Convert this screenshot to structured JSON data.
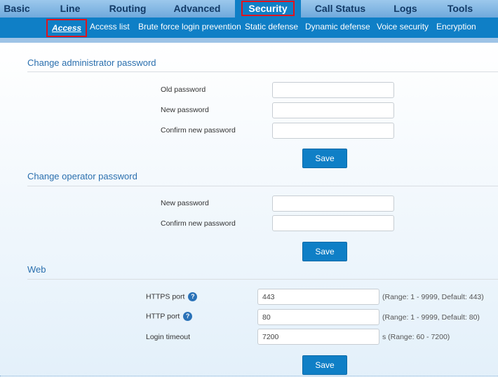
{
  "top_nav": {
    "tabs": [
      {
        "label": "Basic"
      },
      {
        "label": "Line"
      },
      {
        "label": "Routing"
      },
      {
        "label": "Advanced"
      },
      {
        "label": "Security",
        "active": true
      },
      {
        "label": "Call Status"
      },
      {
        "label": "Logs"
      },
      {
        "label": "Tools"
      }
    ]
  },
  "sub_nav": {
    "items": [
      {
        "label": "Access",
        "active": true
      },
      {
        "label": "Access list"
      },
      {
        "label": "Brute force login prevention"
      },
      {
        "label": "Static defense"
      },
      {
        "label": "Dynamic defense"
      },
      {
        "label": "Voice security"
      },
      {
        "label": "Encryption"
      }
    ]
  },
  "admin_password": {
    "title": "Change administrator password",
    "old_label": "Old password",
    "new_label": "New password",
    "confirm_label": "Confirm new password",
    "old_value": "",
    "new_value": "",
    "confirm_value": "",
    "save_label": "Save"
  },
  "operator_password": {
    "title": "Change operator password",
    "new_label": "New password",
    "confirm_label": "Confirm new password",
    "new_value": "",
    "confirm_value": "",
    "save_label": "Save"
  },
  "web": {
    "title": "Web",
    "https_label": "HTTPS port",
    "https_value": "443",
    "https_hint": "(Range: 1 - 9999, Default: 443)",
    "http_label": "HTTP port",
    "http_value": "80",
    "http_hint": "(Range: 1 - 9999, Default: 80)",
    "timeout_label": "Login timeout",
    "timeout_value": "7200",
    "timeout_hint": "s (Range: 60 - 7200)",
    "help_glyph": "?",
    "save_label": "Save"
  },
  "icons": {
    "help": "help-icon"
  },
  "colors": {
    "accent": "#0f7fc6",
    "highlight": "#e0141e",
    "section_title": "#2a6fae"
  }
}
